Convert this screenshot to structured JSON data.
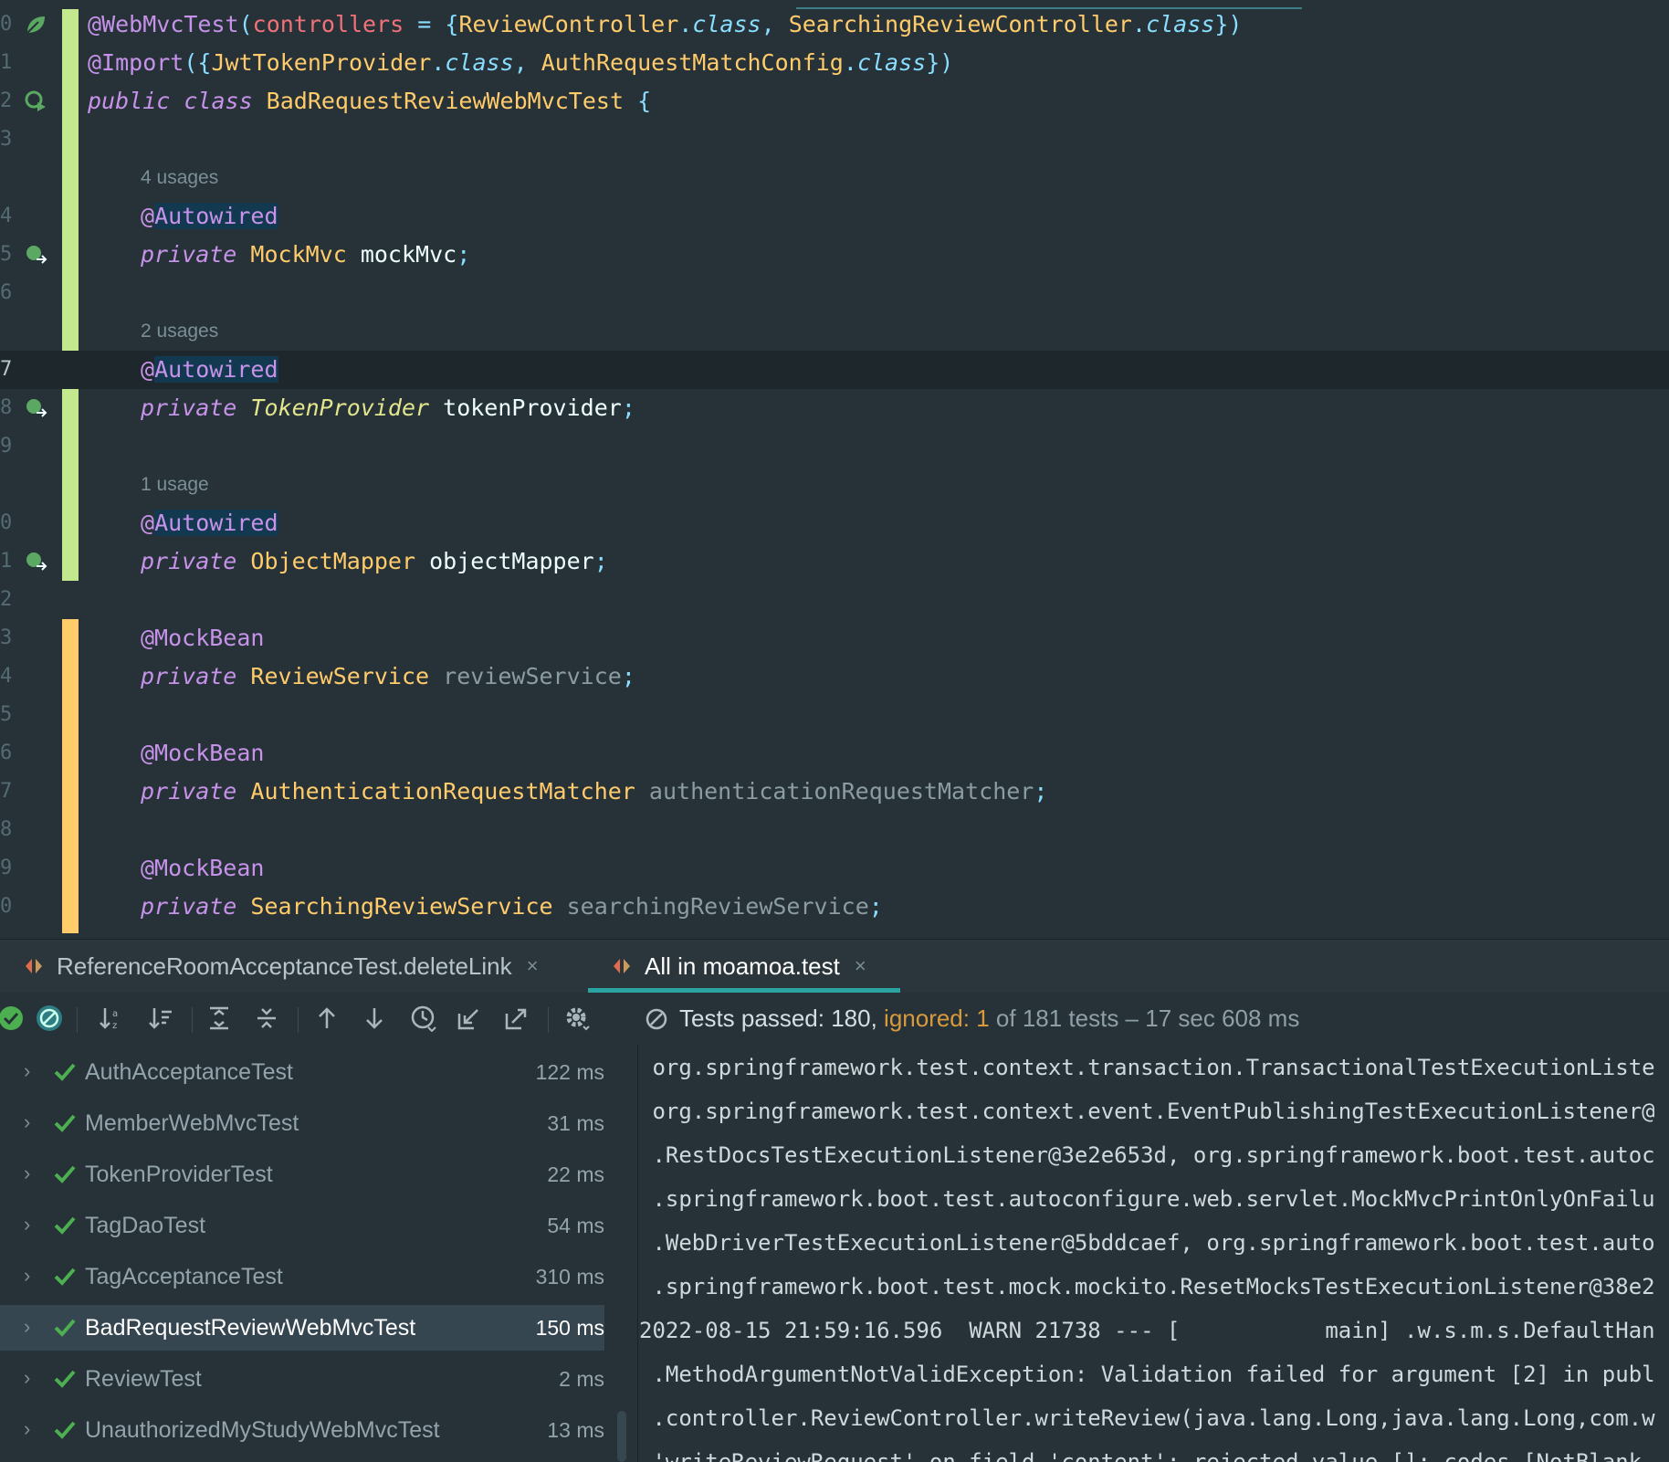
{
  "editor": {
    "usage_hints": [
      "4 usages",
      "2 usages",
      "1 usage"
    ],
    "line_numbers": [
      "0",
      "1",
      "2",
      "3",
      "4",
      "5",
      "6",
      "7",
      "8",
      "9",
      "0",
      "1",
      "2",
      "3",
      "4",
      "5",
      "6",
      "7",
      "8",
      "9",
      "0"
    ],
    "code": {
      "l0": {
        "at": "@",
        "ann": "WebMvcTest",
        "p1": "(",
        "prop": "controllers",
        "eq": " = ",
        "b1": "{",
        "t1": "ReviewController",
        "dot1": ".",
        "c1": "class",
        "comma": ", ",
        "t2": "SearchingReviewController",
        "dot2": ".",
        "c2": "class",
        "close": "})"
      },
      "l1": {
        "ann": "@Import",
        "p1": "({",
        "t1": "JwtTokenProvider",
        "dot1": ".",
        "c1": "class",
        "comma": ", ",
        "t2": "AuthRequestMatchConfig",
        "dot2": ".",
        "c2": "class",
        "close": "})"
      },
      "l2": {
        "kw": "public class ",
        "name": "BadRequestReviewWebMvcTest",
        "brace": " {"
      },
      "f1": {
        "ann_at": "@",
        "ann": "Autowired",
        "kw": "private ",
        "type": "MockMvc",
        "name": " mockMvc",
        "semi": ";"
      },
      "f2": {
        "ann_at": "@",
        "ann": "Autowired",
        "kw": "private ",
        "type": "TokenProvider",
        "name": " tokenProvider",
        "semi": ";"
      },
      "f3": {
        "ann_at": "@",
        "ann": "Autowired",
        "kw": "private ",
        "type": "ObjectMapper",
        "name": " objectMapper",
        "semi": ";"
      },
      "m1": {
        "ann": "@MockBean",
        "kw": "private ",
        "type": "ReviewService",
        "name": " reviewService",
        "semi": ";"
      },
      "m2": {
        "ann": "@MockBean",
        "kw": "private ",
        "type": "AuthenticationRequestMatcher",
        "name": " authenticationRequestMatcher",
        "semi": ";"
      },
      "m3": {
        "ann": "@MockBean",
        "kw": "private ",
        "type": "SearchingReviewService",
        "name": " searchingReviewService",
        "semi": ";"
      }
    }
  },
  "tabs": [
    {
      "label": "ReferenceRoomAcceptanceTest.deleteLink",
      "close": "×"
    },
    {
      "label": "All in moamoa.test",
      "close": "×"
    }
  ],
  "status": {
    "passed": "Tests passed: 180,",
    "ignored": " ignored: 1",
    "rest": " of 181 tests – 17 sec 608 ms"
  },
  "tests": [
    {
      "name": "AuthAcceptanceTest",
      "time": "122 ms"
    },
    {
      "name": "MemberWebMvcTest",
      "time": "31 ms"
    },
    {
      "name": "TokenProviderTest",
      "time": "22 ms"
    },
    {
      "name": "TagDaoTest",
      "time": "54 ms"
    },
    {
      "name": "TagAcceptanceTest",
      "time": "310 ms"
    },
    {
      "name": "BadRequestReviewWebMvcTest",
      "time": "150 ms"
    },
    {
      "name": "ReviewTest",
      "time": "2 ms"
    },
    {
      "name": "UnauthorizedMyStudyWebMvcTest",
      "time": "13 ms"
    }
  ],
  "console_lines": [
    " org.springframework.test.context.transaction.TransactionalTestExecutionListe",
    " org.springframework.test.context.event.EventPublishingTestExecutionListener@",
    " .RestDocsTestExecutionListener@3e2e653d, org.springframework.boot.test.autoc",
    " .springframework.boot.test.autoconfigure.web.servlet.MockMvcPrintOnlyOnFailu",
    " .WebDriverTestExecutionListener@5bddcaef, org.springframework.boot.test.auto",
    " .springframework.boot.test.mock.mockito.ResetMocksTestExecutionListener@38e2",
    "2022-08-15 21:59:16.596  WARN 21738 --- [           main] .w.s.m.s.DefaultHan",
    " .MethodArgumentNotValidException: Validation failed for argument [2] in publ",
    " .controller.ReviewController.writeReview(java.lang.Long,java.lang.Long,com.w",
    " 'writeReviewRequest' on field 'content': rejected value []; codes [NotBlank."
  ],
  "colors": {
    "background": "#263238",
    "accent": "#2aa3a3",
    "pass": "#4caf50",
    "ignored": "#d99a3c"
  }
}
